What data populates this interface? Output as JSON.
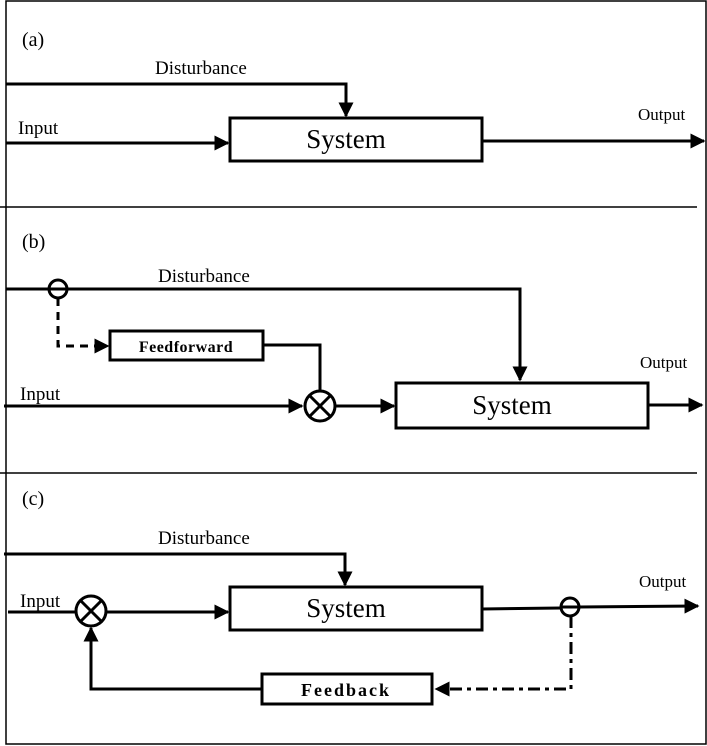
{
  "panels": [
    {
      "label": "(a)",
      "disturbance": "Disturbance",
      "input": "Input",
      "output": "Output",
      "system": "System"
    },
    {
      "label": "(b)",
      "disturbance": "Disturbance",
      "input": "Input",
      "output": "Output",
      "system": "System",
      "controller": "Feedforward"
    },
    {
      "label": "(c)",
      "disturbance": "Disturbance",
      "input": "Input",
      "output": "Output",
      "system": "System",
      "controller": "Feedback"
    }
  ],
  "colors": {
    "stroke": "#000000",
    "background": "#ffffff"
  }
}
